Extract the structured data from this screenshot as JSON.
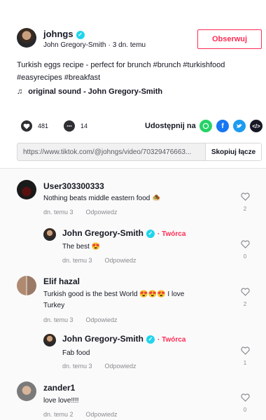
{
  "post": {
    "username": "johngs",
    "display_name": "John Gregory-Smith",
    "time_ago": "3 dn. temu",
    "follow_label": "Obserwuj",
    "description_line1": "Turkish eggs recipe - perfect for brunch #brunch #turkishfood",
    "description_line2": "#easyrecipes #breakfast",
    "sound": "original sound - John Gregory-Smith",
    "likes": "481",
    "comments": "14",
    "share_label": "Udostępnij na",
    "link_url": "https://www.tiktok.com/@johngs/video/70329476663...",
    "copy_label": "Skopiuj łącze"
  },
  "comments": [
    {
      "name": "User303300333",
      "text": "Nothing beats middle eastern food 🧆",
      "time": "dn. temu 3",
      "reply": "Odpowiedz",
      "likes": "2"
    },
    {
      "name": "John Gregory-Smith",
      "creator": "Twórca",
      "text": "The best 😍",
      "time": "dn. temu 3",
      "reply": "Odpowiedz",
      "likes": "0"
    },
    {
      "name": "Elif hazal",
      "text_line1": "Turkish good is the best World 😍😍😍 I love",
      "text_line2": "Turkey",
      "time": "dn. temu 3",
      "reply": "Odpowiedz",
      "likes": "2"
    },
    {
      "name": "John Gregory-Smith",
      "creator": "Twórca",
      "text": "Fab food",
      "time": "dn. temu 3",
      "reply": "Odpowiedz",
      "likes": "1"
    },
    {
      "name": "zander1",
      "text": "love love!!!!",
      "time": "dn. temu 2",
      "reply": "Odpowiedz",
      "likes": "0"
    }
  ],
  "colors": {
    "accent": "#fe2c55",
    "verified": "#20d5ec",
    "whatsapp": "#25d366",
    "facebook": "#1877f2",
    "twitter": "#1d9bf0"
  },
  "icons": [
    "verified-icon",
    "music-note-icon",
    "heart-icon",
    "comment-icon",
    "whatsapp-icon",
    "facebook-icon",
    "twitter-icon",
    "embed-icon"
  ]
}
